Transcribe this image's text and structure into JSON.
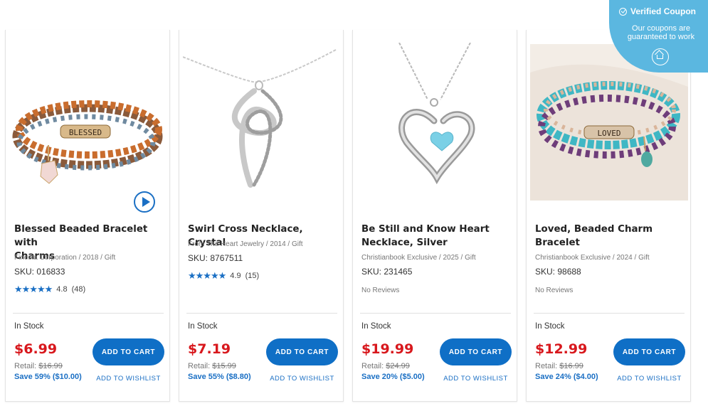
{
  "coupon": {
    "title": "Verified Coupon",
    "line1": "Our coupons are",
    "line2": "guaranteed to work"
  },
  "products": [
    {
      "title_line1": "Blessed Beaded Bracelet with",
      "title_line2": "Charms",
      "meta": "Finesta Corporation / 2018 / Gift",
      "sku": "SKU: 016833",
      "stars": "★★★★★",
      "rating": "4.8",
      "reviews": "(48)",
      "stock": "In Stock",
      "price": "$6.99",
      "retail_label": "Retail:",
      "retail_price": "$16.99",
      "save": "Save 59% ($10.00)",
      "cart": "ADD TO CART",
      "wishlist": "ADD TO WISHLIST",
      "charm_text": "BLESSED"
    },
    {
      "title_line1": "Swirl Cross Necklace, Crystal",
      "meta": "From The Heart Jewelry / 2014 / Gift",
      "sku": "SKU: 8767511",
      "stars": "★★★★★",
      "rating": "4.9",
      "reviews": "(15)",
      "stock": "In Stock",
      "price": "$7.19",
      "retail_label": "Retail:",
      "retail_price": "$15.99",
      "save": "Save 55% ($8.80)",
      "cart": "ADD TO CART",
      "wishlist": "ADD TO WISHLIST"
    },
    {
      "title_line1": "Be Still and Know Heart",
      "title_line2": "Necklace, Silver",
      "meta": "Christianbook Exclusive / 2025 / Gift",
      "sku": "SKU: 231465",
      "no_reviews": "No Reviews",
      "stock": "In Stock",
      "price": "$19.99",
      "retail_label": "Retail:",
      "retail_price": "$24.99",
      "save": "Save 20% ($5.00)",
      "cart": "ADD TO CART",
      "wishlist": "ADD TO WISHLIST"
    },
    {
      "title_line1": "Loved, Beaded Charm",
      "title_line2": "Bracelet",
      "meta": "Christianbook Exclusive / 2024 / Gift",
      "sku": "SKU: 98688",
      "no_reviews": "No Reviews",
      "stock": "In Stock",
      "price": "$12.99",
      "retail_label": "Retail:",
      "retail_price": "$16.99",
      "save": "Save 24% ($4.00)",
      "cart": "ADD TO CART",
      "wishlist": "ADD TO WISHLIST",
      "charm_text": "LOVED"
    }
  ]
}
